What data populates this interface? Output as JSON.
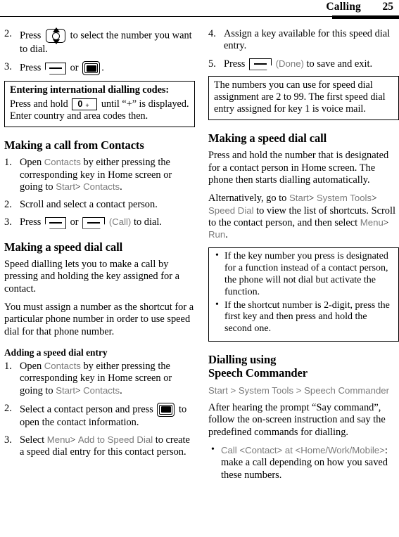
{
  "header": {
    "title": "Calling",
    "page_number": "25"
  },
  "left_column": {
    "steps_continued": [
      {
        "num": "2.",
        "text_before": "Press",
        "icon": "nav-rocker-key-icon",
        "text_after": "to select the number you want to dial."
      },
      {
        "num": "3.",
        "text_before": "Press",
        "icon_1": "send-key-icon",
        "conjunction": "or",
        "icon_2": "ok-key-icon",
        "text_after": "."
      }
    ],
    "callout_intl": {
      "title": "Entering international dialling codes:",
      "text_before": "Press and hold",
      "key_digit": "0",
      "key_plus": "+",
      "text_after": "until “+” is displayed. Enter country and area codes then."
    },
    "section_contacts": {
      "heading": "Making a call from Contacts",
      "steps": [
        {
          "num": "1.",
          "part_1": "Open",
          "ui_1": "Contacts",
          "part_2": "by either pressing the corresponding key in Home screen or going to",
          "ui_2": "Start",
          "sep": ">",
          "ui_3": "Contacts",
          "part_3": "."
        },
        {
          "num": "2.",
          "text": "Scroll and select a contact person."
        },
        {
          "num": "3.",
          "text_before": "Press",
          "icon_1": "send-key-icon",
          "conjunction": "or",
          "icon_2": "soft-key-icon",
          "ui_label": "(Call)",
          "text_after": "to dial."
        }
      ]
    },
    "section_speed_dial": {
      "heading": "Making a speed dial call",
      "paragraph_1": "Speed dialling lets you to make a call by pressing and holding the key assigned for a contact.",
      "paragraph_2": "You must assign a number as the shortcut for a particular phone number in order to use speed dial for that phone number.",
      "subheading": "Adding a speed dial entry",
      "steps": [
        {
          "num": "1.",
          "part_1": "Open",
          "ui_1": "Contacts",
          "part_2": "by either pressing the corresponding key in Home screen or going to",
          "ui_2": "Start",
          "sep": ">",
          "ui_3": "Contacts",
          "part_3": "."
        },
        {
          "num": "2.",
          "text_before": "Select a contact person and press",
          "icon": "ok-key-icon",
          "text_after": "to open the contact information."
        },
        {
          "num": "3.",
          "part_1": "Select",
          "ui_1": "Menu",
          "sep": ">",
          "ui_2": "Add to Speed Dial",
          "part_2": "to create a speed dial entry for this contact person."
        }
      ]
    }
  },
  "right_column": {
    "steps_continued": [
      {
        "num": "4.",
        "text": "Assign a key available for this speed dial entry."
      },
      {
        "num": "5.",
        "text_before": "Press",
        "icon": "soft-key-icon",
        "ui_label": "(Done)",
        "text_after": "to save and exit."
      }
    ],
    "callout_numbers": {
      "text": "The numbers you can use for speed dial assignment are 2 to 99. The first speed dial entry assigned for key 1 is voice mail."
    },
    "section_speed_dial_call": {
      "heading": "Making a speed dial call",
      "paragraph_1": "Press and hold the number that is designated for a contact person in Home screen. The phone then starts dialling automatically.",
      "paragraph_2_part_1": "Alternatively, go to",
      "paragraph_2_ui_1": "Start",
      "paragraph_2_sep_1": ">",
      "paragraph_2_ui_2": "System Tools",
      "paragraph_2_sep_2": ">",
      "paragraph_2_ui_3": "Speed Dial",
      "paragraph_2_part_2": "to view the list of shortcuts. Scroll to the contact person, and then select",
      "paragraph_2_ui_4": "Menu",
      "paragraph_2_sep_3": ">",
      "paragraph_2_ui_5": "Run",
      "paragraph_2_part_3": "."
    },
    "callout_tips": {
      "bullets": [
        "If the key number you press is designated for a function instead of a contact person, the phone will not dial but activate the function.",
        "If the shortcut number is 2-digit, press the first key and then press and hold the second one."
      ]
    },
    "section_speech": {
      "heading_line_1": "Dialling using",
      "heading_line_2": "Speech Commander",
      "breadcrumb": "Start > System Tools > Speech Commander",
      "paragraph_1": "After hearing the prompt “Say command”, follow the on-screen instruction and say the predefined commands for dialling.",
      "bullets": [
        {
          "ui": "Call <Contact> at <Home/Work/Mobile>",
          "text": ": make a call depending on how you saved these numbers."
        }
      ]
    }
  },
  "colors": {
    "ui_term": "#7b7b7b",
    "text": "#000000",
    "background": "#ffffff"
  }
}
